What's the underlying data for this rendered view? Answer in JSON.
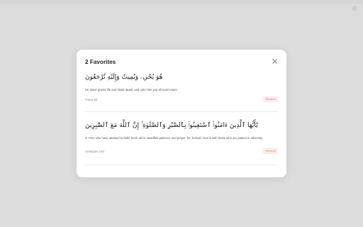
{
  "modal": {
    "title": "2 Favorites",
    "close_icon": "close-icon"
  },
  "favorites": [
    {
      "arabic": "هُوَ يُحْىِۦ وَيُمِيتُ وَإِلَيْهِ تُرْجَعُونَ",
      "translation": "He alone grants life and deals death, and unto Him you all must return.",
      "reference": "Yunus 56",
      "remove_label": "Remove"
    },
    {
      "arabic": "يَٰٓأَيُّهَا ٱلَّذِينَ ءَامَنُوا۟ ٱسْتَعِينُوا۟ بِٱلصَّبْرِ وَٱلصَّلَوٰةِ ۚ إِنَّ ٱللَّهَ مَعَ ٱلصَّٰبِرِينَ",
      "translation": "O YOU who have attained to faith! Seek aid in steadfast patience and prayer: for, behold, God is with those who are patient in adversity.",
      "reference": "Al-Baqara 153",
      "remove_label": "Remove"
    }
  ],
  "colors": {
    "backdrop": "#dcdcdc",
    "modal_bg": "#ffffff",
    "remove_bg": "#fdeaea",
    "remove_text": "#e47f7f"
  }
}
